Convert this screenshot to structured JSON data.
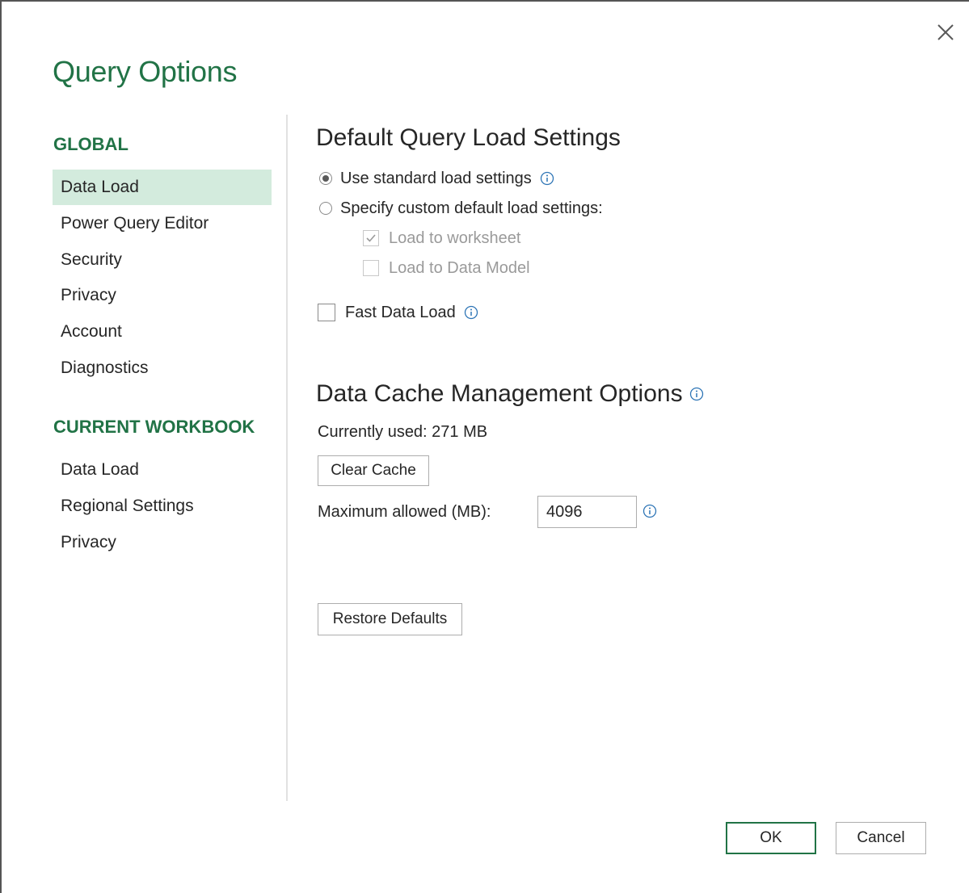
{
  "dialog": {
    "title": "Query Options",
    "close_icon": "close-icon"
  },
  "sidebar": {
    "global_header": "GLOBAL",
    "global_items": [
      {
        "label": "Data Load",
        "selected": true
      },
      {
        "label": "Power Query Editor",
        "selected": false
      },
      {
        "label": "Security",
        "selected": false
      },
      {
        "label": "Privacy",
        "selected": false
      },
      {
        "label": "Account",
        "selected": false
      },
      {
        "label": "Diagnostics",
        "selected": false
      }
    ],
    "workbook_header": "CURRENT WORKBOOK",
    "workbook_items": [
      {
        "label": "Data Load"
      },
      {
        "label": "Regional Settings"
      },
      {
        "label": "Privacy"
      }
    ]
  },
  "load_settings": {
    "heading": "Default Query Load Settings",
    "standard_label": "Use standard load settings",
    "standard_selected": true,
    "custom_label": "Specify custom default load settings:",
    "custom_selected": false,
    "worksheet_label": "Load to worksheet",
    "worksheet_checked": true,
    "data_model_label": "Load to Data Model",
    "data_model_checked": false,
    "fast_load_label": "Fast Data Load",
    "fast_load_checked": false
  },
  "cache": {
    "heading": "Data Cache Management Options",
    "currently_used": "Currently used: 271 MB",
    "clear_button": "Clear Cache",
    "max_label": "Maximum allowed (MB):",
    "max_value": "4096"
  },
  "actions": {
    "restore_defaults": "Restore Defaults",
    "ok": "OK",
    "cancel": "Cancel"
  },
  "colors": {
    "accent": "#217346",
    "selected_bg": "#d3ebdd",
    "info_icon": "#2e75b6"
  }
}
